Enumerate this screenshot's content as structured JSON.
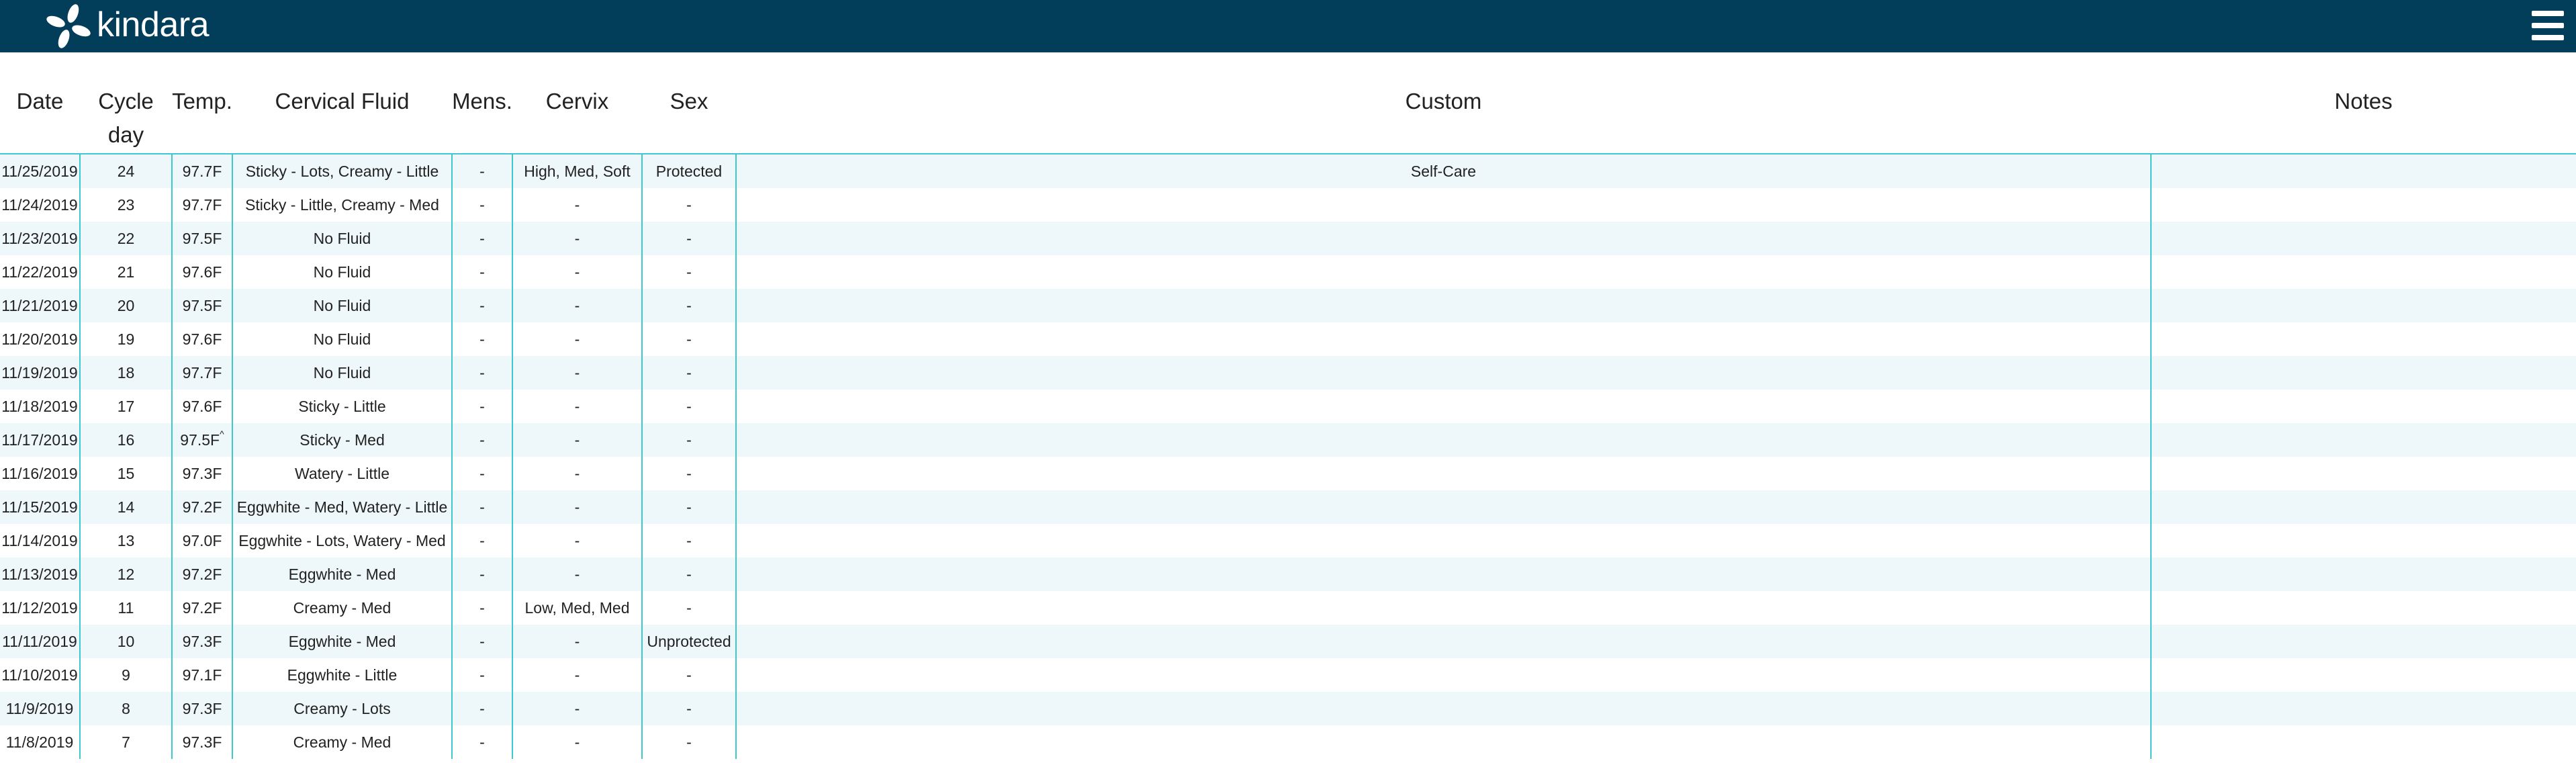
{
  "app": {
    "brand": "kindara",
    "brand_color": "#023e5a",
    "accent_color": "#3fc7d0",
    "logo_icon": "kindara-flower-logo-icon",
    "menu_icon": "hamburger-menu-icon"
  },
  "table": {
    "headers": {
      "date": "Date",
      "cycle_day_line1": "Cycle",
      "cycle_day_line2": "day",
      "temp": "Temp.",
      "cervical_fluid": "Cervical Fluid",
      "mens": "Mens.",
      "cervix": "Cervix",
      "sex": "Sex",
      "custom": "Custom",
      "notes": "Notes"
    },
    "rows": [
      {
        "date": "11/25/2019",
        "day": "24",
        "temp": "97.7F",
        "fluid": "Sticky - Lots, Creamy - Little",
        "mens": "-",
        "cervix": "High, Med, Soft",
        "sex": "Protected",
        "custom": "Self-Care",
        "notes": ""
      },
      {
        "date": "11/24/2019",
        "day": "23",
        "temp": "97.7F",
        "fluid": "Sticky - Little, Creamy - Med",
        "mens": "-",
        "cervix": "-",
        "sex": "-",
        "custom": "",
        "notes": ""
      },
      {
        "date": "11/23/2019",
        "day": "22",
        "temp": "97.5F",
        "fluid": "No Fluid",
        "mens": "-",
        "cervix": "-",
        "sex": "-",
        "custom": "",
        "notes": ""
      },
      {
        "date": "11/22/2019",
        "day": "21",
        "temp": "97.6F",
        "fluid": "No Fluid",
        "mens": "-",
        "cervix": "-",
        "sex": "-",
        "custom": "",
        "notes": ""
      },
      {
        "date": "11/21/2019",
        "day": "20",
        "temp": "97.5F",
        "fluid": "No Fluid",
        "mens": "-",
        "cervix": "-",
        "sex": "-",
        "custom": "",
        "notes": ""
      },
      {
        "date": "11/20/2019",
        "day": "19",
        "temp": "97.6F",
        "fluid": "No Fluid",
        "mens": "-",
        "cervix": "-",
        "sex": "-",
        "custom": "",
        "notes": ""
      },
      {
        "date": "11/19/2019",
        "day": "18",
        "temp": "97.7F",
        "fluid": "No Fluid",
        "mens": "-",
        "cervix": "-",
        "sex": "-",
        "custom": "",
        "notes": ""
      },
      {
        "date": "11/18/2019",
        "day": "17",
        "temp": "97.6F",
        "fluid": "Sticky - Little",
        "mens": "-",
        "cervix": "-",
        "sex": "-",
        "custom": "",
        "notes": ""
      },
      {
        "date": "11/17/2019",
        "day": "16",
        "temp": "97.5F",
        "temp_mark": "^",
        "fluid": "Sticky - Med",
        "mens": "-",
        "cervix": "-",
        "sex": "-",
        "custom": "",
        "notes": ""
      },
      {
        "date": "11/16/2019",
        "day": "15",
        "temp": "97.3F",
        "fluid": "Watery - Little",
        "mens": "-",
        "cervix": "-",
        "sex": "-",
        "custom": "",
        "notes": ""
      },
      {
        "date": "11/15/2019",
        "day": "14",
        "temp": "97.2F",
        "fluid": "Eggwhite - Med, Watery - Little",
        "mens": "-",
        "cervix": "-",
        "sex": "-",
        "custom": "",
        "notes": ""
      },
      {
        "date": "11/14/2019",
        "day": "13",
        "temp": "97.0F",
        "fluid": "Eggwhite - Lots, Watery - Med",
        "mens": "-",
        "cervix": "-",
        "sex": "-",
        "custom": "",
        "notes": ""
      },
      {
        "date": "11/13/2019",
        "day": "12",
        "temp": "97.2F",
        "fluid": "Eggwhite - Med",
        "mens": "-",
        "cervix": "-",
        "sex": "-",
        "custom": "",
        "notes": ""
      },
      {
        "date": "11/12/2019",
        "day": "11",
        "temp": "97.2F",
        "fluid": "Creamy - Med",
        "mens": "-",
        "cervix": "Low, Med, Med",
        "sex": "-",
        "custom": "",
        "notes": ""
      },
      {
        "date": "11/11/2019",
        "day": "10",
        "temp": "97.3F",
        "fluid": "Eggwhite - Med",
        "mens": "-",
        "cervix": "-",
        "sex": "Unprotected",
        "custom": "",
        "notes": ""
      },
      {
        "date": "11/10/2019",
        "day": "9",
        "temp": "97.1F",
        "fluid": "Eggwhite - Little",
        "mens": "-",
        "cervix": "-",
        "sex": "-",
        "custom": "",
        "notes": ""
      },
      {
        "date": "11/9/2019",
        "day": "8",
        "temp": "97.3F",
        "fluid": "Creamy - Lots",
        "mens": "-",
        "cervix": "-",
        "sex": "-",
        "custom": "",
        "notes": ""
      },
      {
        "date": "11/8/2019",
        "day": "7",
        "temp": "97.3F",
        "fluid": "Creamy - Med",
        "mens": "-",
        "cervix": "-",
        "sex": "-",
        "custom": "",
        "notes": ""
      }
    ]
  }
}
